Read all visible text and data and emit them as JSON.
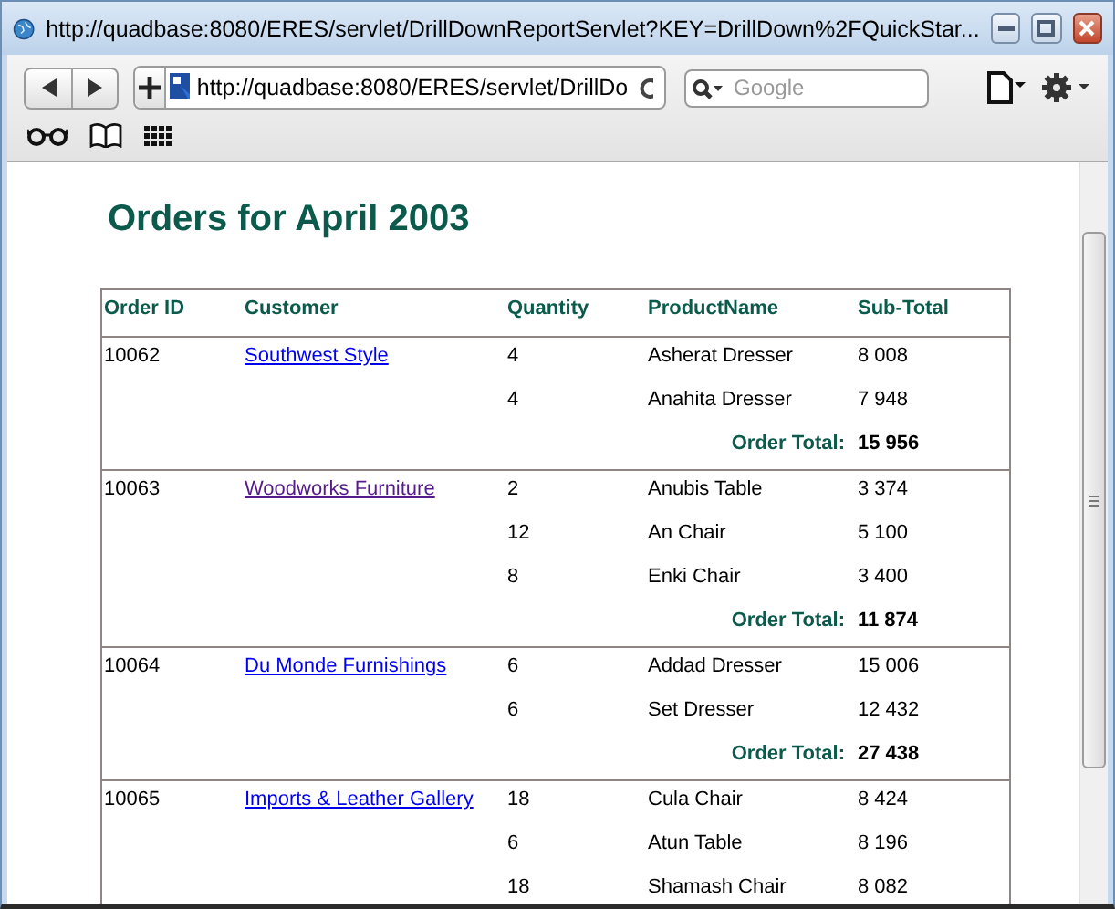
{
  "window": {
    "title": "http://quadbase:8080/ERES/servlet/DrillDownReportServlet?KEY=DrillDown%2FQuickStar..."
  },
  "toolbar": {
    "address": "http://quadbase:8080/ERES/servlet/DrillDo",
    "search_placeholder": "Google"
  },
  "report": {
    "title": "Orders for April 2003",
    "columns": [
      "Order ID",
      "Customer",
      "Quantity",
      "ProductName",
      "Sub-Total"
    ],
    "orders": [
      {
        "order_id": "10062",
        "customer": "Southwest Style",
        "visited": false,
        "lines": [
          {
            "quantity": "4",
            "product": "Asherat Dresser",
            "subtotal": "8 008"
          },
          {
            "quantity": "4",
            "product": "Anahita Dresser",
            "subtotal": "7 948"
          }
        ],
        "total_label": "Order Total:",
        "total": "15 956"
      },
      {
        "order_id": "10063",
        "customer": "Woodworks Furniture",
        "visited": true,
        "lines": [
          {
            "quantity": "2",
            "product": "Anubis Table",
            "subtotal": "3 374"
          },
          {
            "quantity": "12",
            "product": "An Chair",
            "subtotal": "5 100"
          },
          {
            "quantity": "8",
            "product": "Enki Chair",
            "subtotal": "3 400"
          }
        ],
        "total_label": "Order Total:",
        "total": "11 874"
      },
      {
        "order_id": "10064",
        "customer": "Du Monde Furnishings",
        "visited": false,
        "lines": [
          {
            "quantity": "6",
            "product": "Addad Dresser",
            "subtotal": "15 006"
          },
          {
            "quantity": "6",
            "product": "Set Dresser",
            "subtotal": "12 432"
          }
        ],
        "total_label": "Order Total:",
        "total": "27 438"
      },
      {
        "order_id": "10065",
        "customer": "Imports & Leather Gallery",
        "visited": false,
        "lines": [
          {
            "quantity": "18",
            "product": "Cula Chair",
            "subtotal": "8 424"
          },
          {
            "quantity": "6",
            "product": "Atun Table",
            "subtotal": "8 196"
          },
          {
            "quantity": "18",
            "product": "Shamash Chair",
            "subtotal": "8 082"
          }
        ]
      }
    ]
  }
}
